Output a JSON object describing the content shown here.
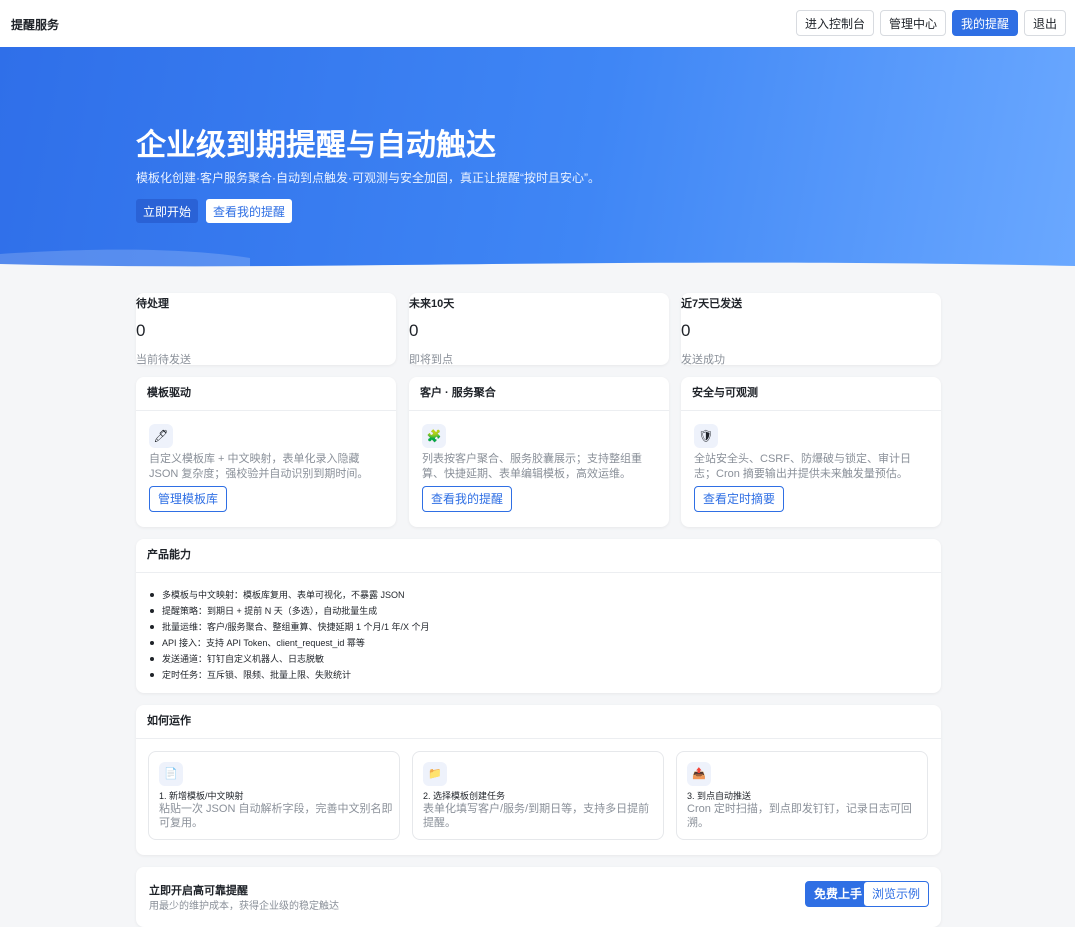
{
  "header": {
    "brand": "提醒服务",
    "nav": [
      {
        "label": "进入控制台"
      },
      {
        "label": "管理中心"
      },
      {
        "label": "我的提醒"
      },
      {
        "label": "退出"
      }
    ]
  },
  "hero": {
    "title": "企业级到期提醒与自动触达",
    "subtitle": "模板化创建·客户服务聚合·自动到点触发·可观测与安全加固，真正让提醒“按时且安心”。",
    "primary_btn": "立即开始",
    "secondary_btn": "查看我的提醒"
  },
  "stats": [
    {
      "label": "待处理",
      "value": "0",
      "sub": "当前待发送"
    },
    {
      "label": "未来10天",
      "value": "0",
      "sub": "即将到点"
    },
    {
      "label": "近7天已发送",
      "value": "0",
      "sub": "发送成功"
    }
  ],
  "features": [
    {
      "title": "模板驱动",
      "icon": "pencil-icon",
      "glyph": "🖊",
      "text": "自定义模板库 + 中文映射，表单化录入隐藏 JSON 复杂度；强校验并自动识别到期时间。",
      "button": "管理模板库"
    },
    {
      "title": "客户 · 服务聚合",
      "icon": "puzzle-icon",
      "glyph": "🧩",
      "text": "列表按客户聚合、服务胶囊展示；支持整组重算、快捷延期、表单编辑模板，高效运维。",
      "button": "查看我的提醒"
    },
    {
      "title": "安全与可观测",
      "icon": "shield-icon",
      "glyph": "🛡",
      "text": "全站安全头、CSRF、防爆破与锁定、审计日志；Cron 摘要输出并提供未来触发量预估。",
      "button": "查看定时摘要"
    }
  ],
  "capabilities": {
    "title": "产品能力",
    "items": [
      "多模板与中文映射：模板库复用、表单可视化，不暴露 JSON",
      "提醒策略：到期日 + 提前 N 天（多选），自动批量生成",
      "批量运维：客户/服务聚合、整组重算、快捷延期 1 个月/1 年/X 个月",
      "API 接入：支持 API Token、client_request_id 幂等",
      "发送通道：钉钉自定义机器人、日志脱敏",
      "定时任务：互斥锁、限频、批量上限、失败统计"
    ]
  },
  "how": {
    "title": "如何运作",
    "steps": [
      {
        "icon": "document-icon",
        "glyph": "📄",
        "title": "1. 新增模板/中文映射",
        "text": "粘贴一次 JSON 自动解析字段，完善中文别名即可复用。"
      },
      {
        "icon": "folder-icon",
        "glyph": "📁",
        "title": "2. 选择模板创建任务",
        "text": "表单化填写客户/服务/到期日等，支持多日提前提醒。"
      },
      {
        "icon": "outbox-icon",
        "glyph": "📤",
        "title": "3. 到点自动推送",
        "text": "Cron 定时扫描，到点即发钉钉，记录日志可回溯。"
      }
    ]
  },
  "cta": {
    "title": "立即开启高可靠提醒",
    "subtitle": "用最少的维护成本，获得企业级的稳定触达",
    "primary_btn": "免费上手",
    "secondary_btn": "浏览示例"
  }
}
